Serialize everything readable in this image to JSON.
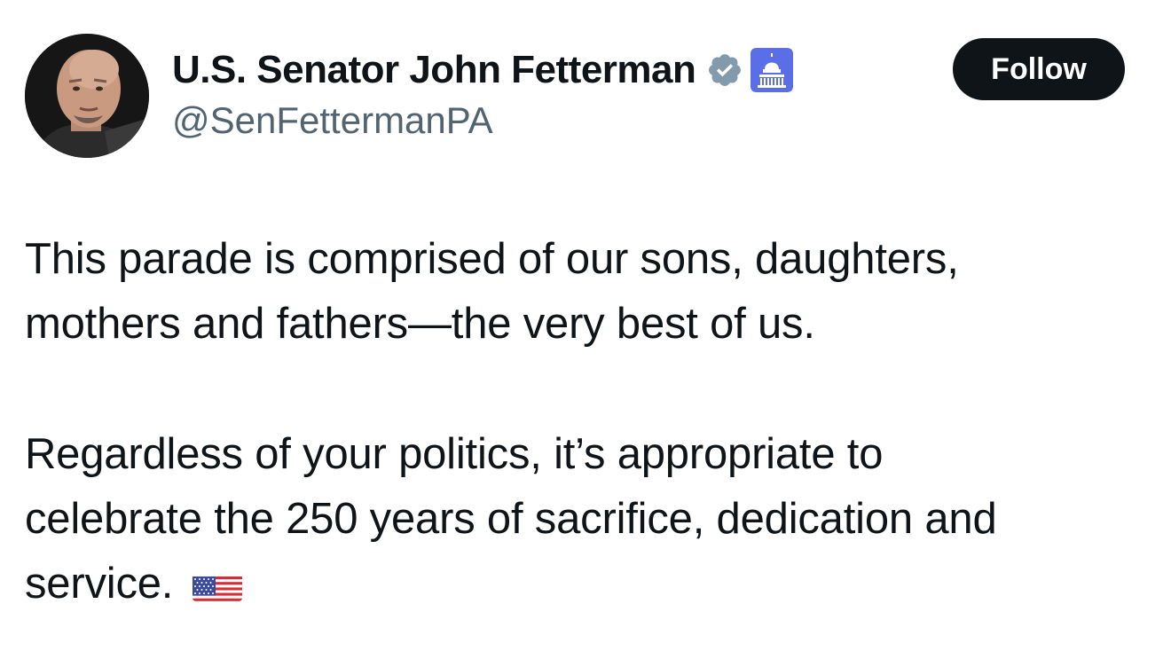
{
  "author": {
    "display_name": "U.S. Senator John Fetterman",
    "handle": "@SenFettermanPA",
    "verified_badge": "verified-badge-gray",
    "affiliation_badge": "us-capitol-icon"
  },
  "actions": {
    "follow_label": "Follow"
  },
  "tweet": {
    "paragraph1": [
      "This parade is comprised of our sons, daughters,",
      "mothers and fathers—the very best of us."
    ],
    "paragraph2": [
      "Regardless of your politics, it’s appropriate to",
      "celebrate the 250 years of sacrifice, dedication and",
      "service."
    ],
    "emoji": "us-flag-icon"
  },
  "colors": {
    "text_primary": "#0f1419",
    "text_secondary": "#536471",
    "button_bg": "#0f1419",
    "verified_gray": "#829aab",
    "capitol_badge": "#5a6fe6"
  }
}
